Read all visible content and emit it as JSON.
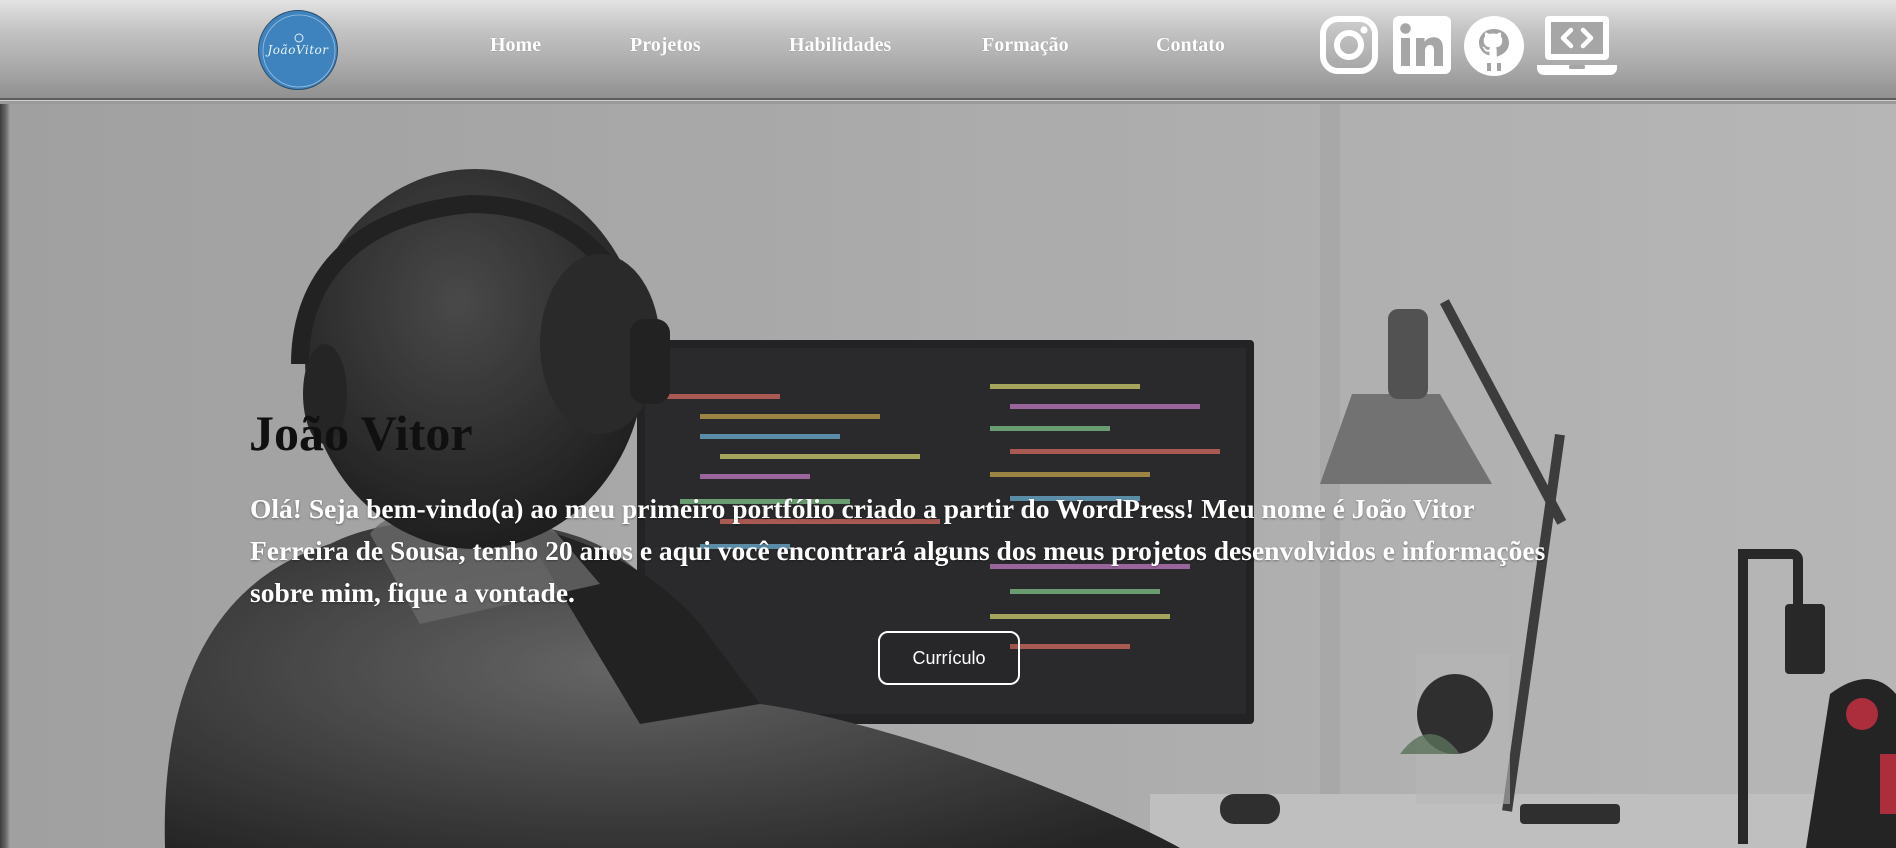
{
  "header": {
    "logo": {
      "text": "JoãoVitor",
      "icon": "monogram-logo"
    },
    "nav": [
      {
        "label": "Home"
      },
      {
        "label": "Projetos"
      },
      {
        "label": "Habilidades"
      },
      {
        "label": "Formação"
      },
      {
        "label": "Contato"
      }
    ],
    "social": [
      {
        "icon": "instagram-icon"
      },
      {
        "icon": "linkedin-icon"
      },
      {
        "icon": "github-icon"
      },
      {
        "icon": "laptop-code-icon"
      }
    ]
  },
  "hero": {
    "title": "João Vitor",
    "text": "Olá! Seja bem-vindo(a) ao meu primeiro portfólio criado a partir do WordPress! Meu nome é João Vitor Ferreira de Sousa, tenho 20 anos e aqui você encontrará alguns dos meus projetos desenvolvidos e informações sobre mim,  fique a vontade.",
    "button": "Currículo",
    "background": "person-with-headphones-at-desk-coding-photo"
  },
  "colors": {
    "header_top": "#e3e3e3",
    "header_bottom": "#909090",
    "logo_bg": "#3f83be",
    "nav_text": "#ffffff",
    "title_text": "#101010",
    "body_text": "#ffffff",
    "button_border": "#ffffff"
  }
}
